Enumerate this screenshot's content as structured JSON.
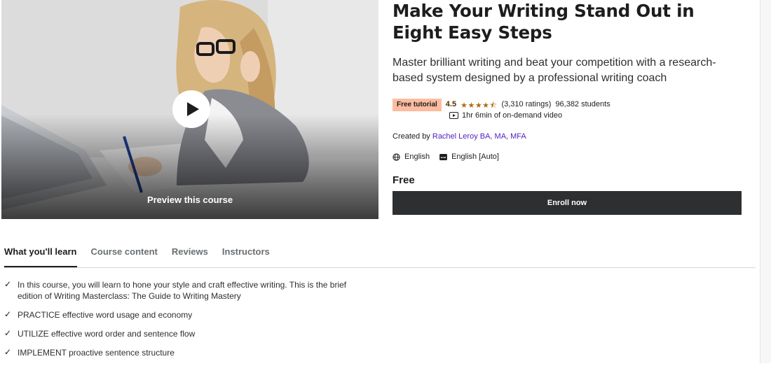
{
  "preview": {
    "label": "Preview this course",
    "play_icon": "play-icon"
  },
  "course": {
    "title": "Make Your Writing Stand Out in Eight Easy Steps",
    "subtitle": "Master brilliant writing and beat your competition with a research-based system designed by a professional writing coach",
    "badge": "Free tutorial",
    "rating": "4.5",
    "stars": "★★★★⯪",
    "ratings_count": "(3,310 ratings)",
    "students": "96,382 students",
    "duration": "1hr 6min of on-demand video",
    "created_by_label": "Created by",
    "instructor": "Rachel Leroy BA, MA, MFA",
    "language": "English",
    "captions": "English [Auto]",
    "price": "Free",
    "enroll_label": "Enroll now",
    "colors": {
      "badge_bg": "#fcbca0",
      "star": "#b4690e",
      "link": "#5022c3",
      "enroll_bg": "#2d2f31"
    }
  },
  "tabs": [
    {
      "label": "What you'll learn",
      "active": true
    },
    {
      "label": "Course content",
      "active": false
    },
    {
      "label": "Reviews",
      "active": false
    },
    {
      "label": "Instructors",
      "active": false
    }
  ],
  "learn_items": [
    "In this course, you will learn to hone your style and craft effective writing. This is the brief edition of Writing Masterclass: The Guide to Writing Mastery",
    "PRACTICE effective word usage and economy",
    "UTILIZE effective word order and sentence flow",
    "IMPLEMENT proactive sentence structure"
  ],
  "check_glyph": "✓"
}
